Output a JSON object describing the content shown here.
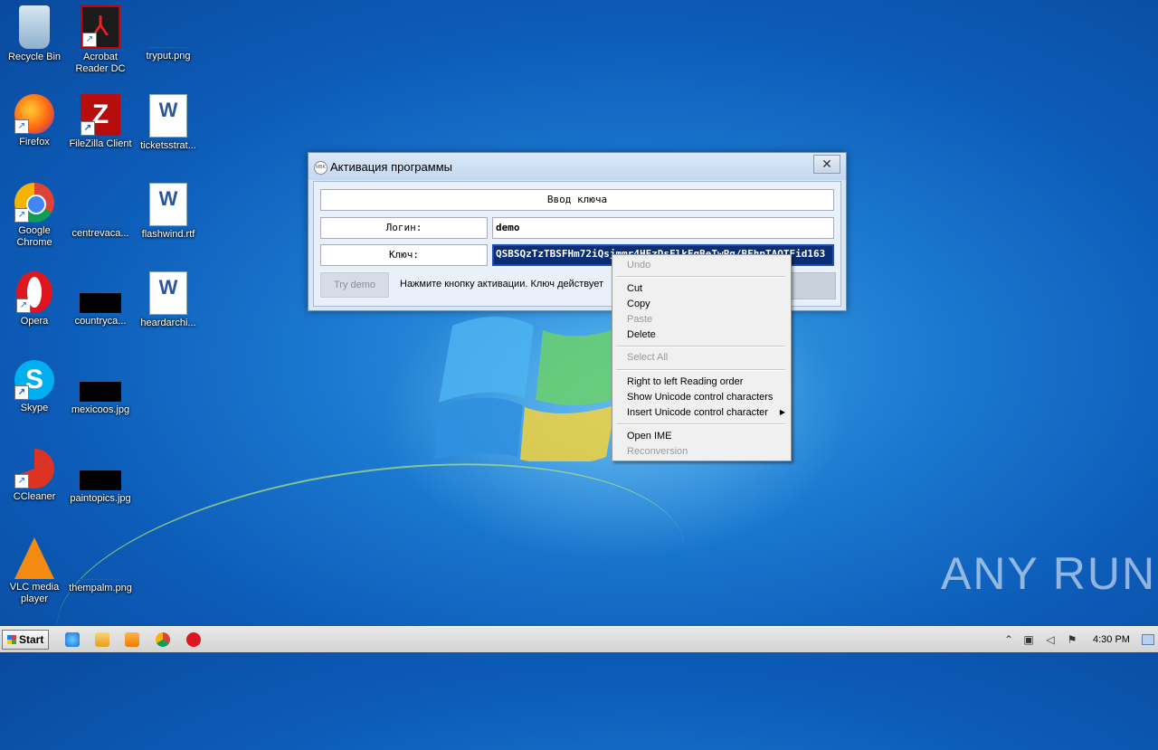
{
  "desktop": {
    "icons": [
      {
        "label": "Recycle Bin"
      },
      {
        "label": "Acrobat Reader DC"
      },
      {
        "label": "tryput.png"
      },
      {
        "label": "Firefox"
      },
      {
        "label": "FileZilla Client"
      },
      {
        "label": "ticketsstrat..."
      },
      {
        "label": "Google Chrome"
      },
      {
        "label": "centrevaca..."
      },
      {
        "label": "flashwind.rtf"
      },
      {
        "label": "Opera"
      },
      {
        "label": "countryca..."
      },
      {
        "label": "heardarchi..."
      },
      {
        "label": "Skype"
      },
      {
        "label": "mexicoos.jpg"
      },
      {
        "label": "CCleaner"
      },
      {
        "label": "paintopics.jpg"
      },
      {
        "label": "VLC media player"
      },
      {
        "label": "thempalm.png"
      }
    ],
    "watermark": "ANY RUN"
  },
  "dialog": {
    "title": "Активация программы",
    "title_icon_text": "MBK",
    "close_glyph": "✕",
    "header_label": "Ввод ключа",
    "login_label": "Логин:",
    "login_value": "demo",
    "key_label": "Ключ:",
    "key_value": "QSBSQzTzTBSFHm72iQsjmmr4HEzDsFlkFqBeTwPq/BFhpTAQTFid163",
    "try_demo_label": "Try demo",
    "hint_text": "Нажмите кнопку активации. Ключ действует"
  },
  "context_menu": {
    "items": [
      {
        "label": "Undo",
        "enabled": false
      },
      {
        "label": "Cut",
        "enabled": true
      },
      {
        "label": "Copy",
        "enabled": true
      },
      {
        "label": "Paste",
        "enabled": false
      },
      {
        "label": "Delete",
        "enabled": true
      },
      {
        "label": "Select All",
        "enabled": false
      },
      {
        "label": "Right to left Reading order",
        "enabled": true
      },
      {
        "label": "Show Unicode control characters",
        "enabled": true
      },
      {
        "label": "Insert Unicode control character",
        "enabled": true,
        "submenu": true
      },
      {
        "label": "Open IME",
        "enabled": true
      },
      {
        "label": "Reconversion",
        "enabled": false
      }
    ]
  },
  "taskbar": {
    "start_label": "Start",
    "pinned": [
      "ie-icon",
      "explorer-icon",
      "media-player-icon",
      "chrome-icon",
      "opera-icon"
    ],
    "clock": "4:30 PM"
  },
  "colors": {
    "key_selection_bg": "#0b2d73",
    "dialog_bg": "#d8e6f6",
    "desktop_bg": "#1b78cf"
  }
}
